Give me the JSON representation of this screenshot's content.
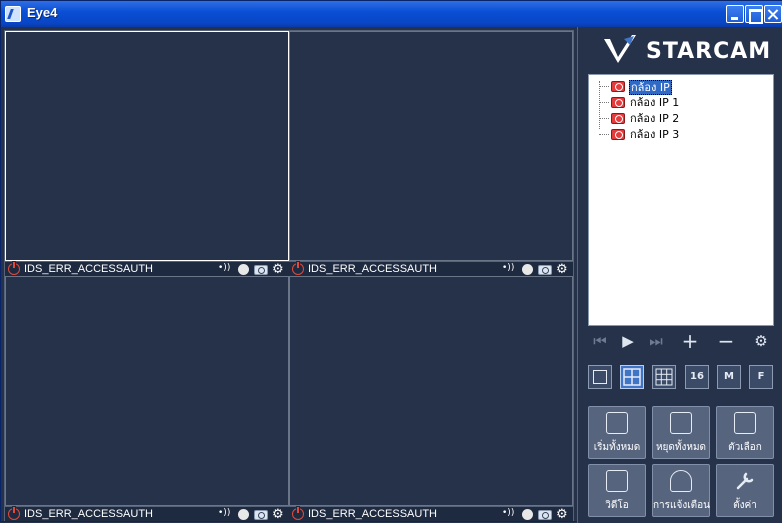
{
  "window": {
    "title": "Eye4"
  },
  "logo": {
    "text": "STARCAM"
  },
  "panes": [
    {
      "status": "IDS_ERR_ACCESSAUTH",
      "audio_glyph": "•))"
    },
    {
      "status": "IDS_ERR_ACCESSAUTH",
      "audio_glyph": "•))"
    },
    {
      "status": "IDS_ERR_ACCESSAUTH",
      "audio_glyph": "•))"
    },
    {
      "status": "IDS_ERR_ACCESSAUTH",
      "audio_glyph": "•))"
    }
  ],
  "device_tree": {
    "items": [
      {
        "label": "กล้อง IP",
        "selected": true
      },
      {
        "label": "กล้อง IP 1"
      },
      {
        "label": "กล้อง IP 2"
      },
      {
        "label": "กล้อง IP 3"
      }
    ]
  },
  "tree_controls": {
    "prev": "⏮",
    "play": "▶",
    "next": "⏭",
    "add": "+",
    "remove": "−",
    "settings": "⚙"
  },
  "layouts": {
    "single": "",
    "quad": "",
    "nine": "",
    "sixteen": "16",
    "m": "M",
    "f": "F",
    "selected": "quad"
  },
  "actions": {
    "start_all": "เริ่มทั้งหมด",
    "stop_all": "หยุดทั้งหมด",
    "options": "ตัวเลือก",
    "video": "วิดีโอ",
    "alerts": "การแจ้งเตือน",
    "settings": "ตั้งค่า"
  },
  "colors": {
    "background": "#25324a",
    "titlebar": "#0a4fd6",
    "selection": "#316ac5"
  }
}
